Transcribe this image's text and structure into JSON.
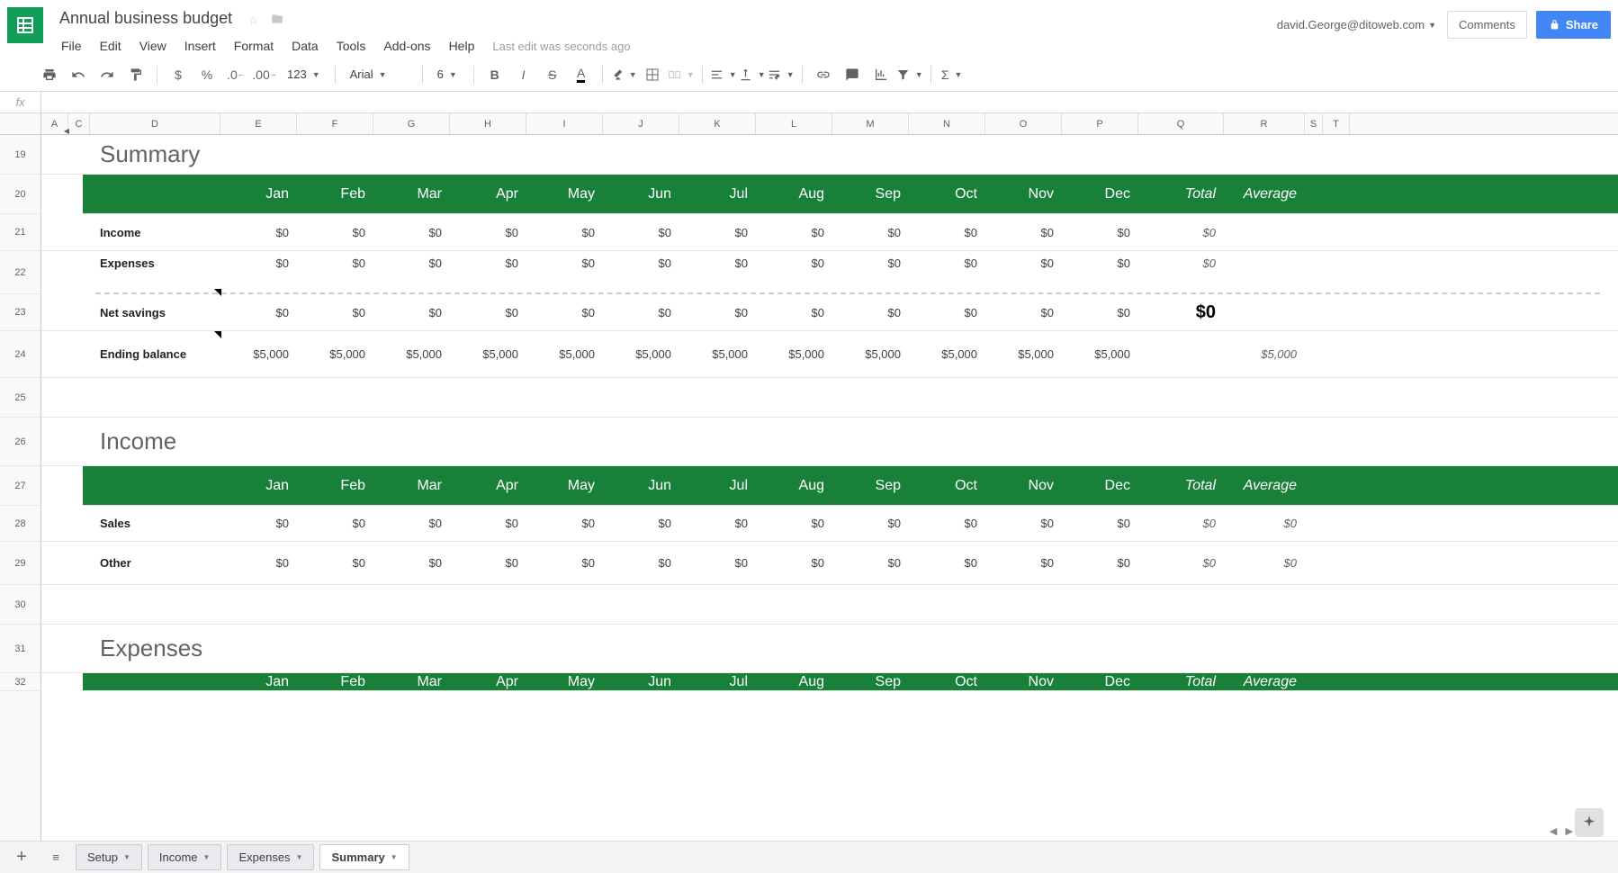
{
  "doc": {
    "title": "Annual business budget",
    "last_edit": "Last edit was seconds ago",
    "user_email": "david.George@ditoweb.com"
  },
  "menu": {
    "file": "File",
    "edit": "Edit",
    "view": "View",
    "insert": "Insert",
    "format": "Format",
    "data": "Data",
    "tools": "Tools",
    "addons": "Add-ons",
    "help": "Help"
  },
  "buttons": {
    "comments": "Comments",
    "share": "Share"
  },
  "toolbar": {
    "font": "Arial",
    "size": "6",
    "num_fmt": "123"
  },
  "columns": [
    "A",
    "C",
    "D",
    "E",
    "F",
    "G",
    "H",
    "I",
    "J",
    "K",
    "L",
    "M",
    "N",
    "O",
    "P",
    "Q",
    "R",
    "S",
    "T"
  ],
  "row_numbers": [
    "19",
    "20",
    "21",
    "22",
    "23",
    "24",
    "25",
    "26",
    "27",
    "28",
    "29",
    "30",
    "31",
    "32"
  ],
  "months": [
    "Jan",
    "Feb",
    "Mar",
    "Apr",
    "May",
    "Jun",
    "Jul",
    "Aug",
    "Sep",
    "Oct",
    "Nov",
    "Dec"
  ],
  "headers": {
    "total": "Total",
    "average": "Average"
  },
  "sections": {
    "summary": {
      "title": "Summary",
      "rows": {
        "income": {
          "label": "Income",
          "cells": [
            "$0",
            "$0",
            "$0",
            "$0",
            "$0",
            "$0",
            "$0",
            "$0",
            "$0",
            "$0",
            "$0",
            "$0"
          ],
          "total": "$0",
          "avg": ""
        },
        "expenses": {
          "label": "Expenses",
          "cells": [
            "$0",
            "$0",
            "$0",
            "$0",
            "$0",
            "$0",
            "$0",
            "$0",
            "$0",
            "$0",
            "$0",
            "$0"
          ],
          "total": "$0",
          "avg": ""
        },
        "net": {
          "label": "Net savings",
          "cells": [
            "$0",
            "$0",
            "$0",
            "$0",
            "$0",
            "$0",
            "$0",
            "$0",
            "$0",
            "$0",
            "$0",
            "$0"
          ],
          "total": "$0",
          "avg": ""
        },
        "ending": {
          "label": "Ending balance",
          "cells": [
            "$5,000",
            "$5,000",
            "$5,000",
            "$5,000",
            "$5,000",
            "$5,000",
            "$5,000",
            "$5,000",
            "$5,000",
            "$5,000",
            "$5,000",
            "$5,000"
          ],
          "total": "",
          "avg": "$5,000"
        }
      }
    },
    "income": {
      "title": "Income",
      "rows": {
        "sales": {
          "label": "Sales",
          "cells": [
            "$0",
            "$0",
            "$0",
            "$0",
            "$0",
            "$0",
            "$0",
            "$0",
            "$0",
            "$0",
            "$0",
            "$0"
          ],
          "total": "$0",
          "avg": "$0"
        },
        "other": {
          "label": "Other",
          "cells": [
            "$0",
            "$0",
            "$0",
            "$0",
            "$0",
            "$0",
            "$0",
            "$0",
            "$0",
            "$0",
            "$0",
            "$0"
          ],
          "total": "$0",
          "avg": "$0"
        }
      }
    },
    "expenses": {
      "title": "Expenses"
    }
  },
  "tabs": {
    "setup": "Setup",
    "income": "Income",
    "expenses": "Expenses",
    "summary": "Summary"
  }
}
